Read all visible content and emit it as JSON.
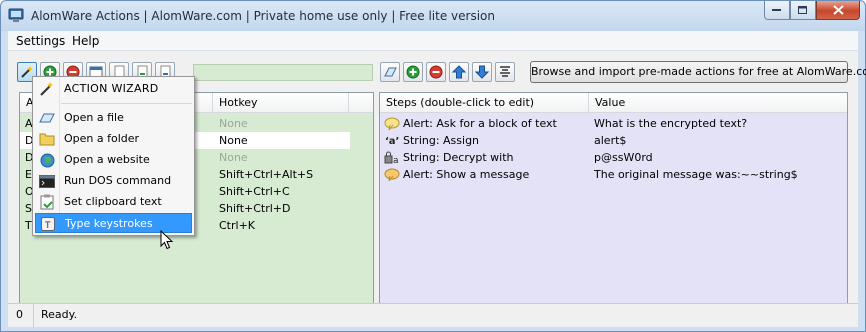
{
  "window": {
    "title": "AlomWare Actions  |  AlomWare.com  |  Private home use only  |  Free lite version"
  },
  "menu": {
    "settings": "Settings",
    "help": "Help"
  },
  "toolbar": {
    "browse_label": "Browse and import pre-made actions for free at AlomWare.com"
  },
  "actions_list": {
    "columns": {
      "name": "A",
      "hotkey": "Hotkey"
    },
    "rows": [
      {
        "name_initial": "A",
        "hotkey": "None",
        "hotkey_none": true
      },
      {
        "name_initial": "D",
        "hotkey": "None",
        "hotkey_none": false,
        "selected": true
      },
      {
        "name_initial": "D",
        "hotkey": "None",
        "hotkey_none": true
      },
      {
        "name_initial": "E",
        "hotkey": "Shift+Ctrl+Alt+S",
        "hotkey_none": false
      },
      {
        "name_initial": "O",
        "hotkey": "Shift+Ctrl+C",
        "hotkey_none": false
      },
      {
        "name_initial": "S",
        "hotkey": "Shift+Ctrl+D",
        "hotkey_none": false
      },
      {
        "name_initial": "T",
        "hotkey": "Ctrl+K",
        "hotkey_none": false
      }
    ]
  },
  "steps_list": {
    "columns": {
      "steps": "Steps  (double-click to edit)",
      "value": "Value"
    },
    "rows": [
      {
        "icon": "alert-ask-icon",
        "step": "Alert: Ask for a block of text",
        "value": "What is the encrypted text?"
      },
      {
        "icon": "string-assign-icon",
        "glyph": "'a'",
        "step": "String: Assign",
        "value": "alert$"
      },
      {
        "icon": "string-decrypt-icon",
        "glyph": "a",
        "step": "String: Decrypt with",
        "value": "p@ssW0rd"
      },
      {
        "icon": "alert-message-icon",
        "step": "Alert: Show a message",
        "value": "The original message was:~~string$"
      }
    ]
  },
  "popup_menu": {
    "header": "ACTION WIZARD",
    "items": [
      {
        "label": "Open a file",
        "icon": "file-icon"
      },
      {
        "label": "Open a folder",
        "icon": "folder-icon"
      },
      {
        "label": "Open a website",
        "icon": "globe-icon"
      },
      {
        "label": "Run DOS command",
        "icon": "terminal-icon"
      },
      {
        "label": "Set clipboard text",
        "icon": "clipboard-icon"
      },
      {
        "label": "Type keystrokes",
        "icon": "keyboard-icon",
        "highlighted": true
      }
    ]
  },
  "status": {
    "count": "0",
    "text": "Ready."
  },
  "colors": {
    "actions_bg": "#d7ebd3",
    "steps_bg": "#e4e2f7",
    "highlight": "#3399ff"
  }
}
